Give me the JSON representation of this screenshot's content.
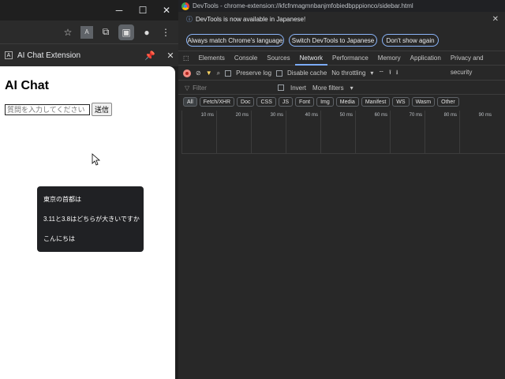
{
  "browser": {
    "side_panel_title": "AI Chat Extension",
    "app": {
      "title": "AI Chat",
      "input_placeholder": "質問を入力してください",
      "send_label": "送信",
      "suggestions": [
        "東京の首都は",
        "3.11と3.8はどちらが大きいですか",
        "こんにちは"
      ]
    }
  },
  "devtools": {
    "window_title": "DevTools - chrome-extension://kfcfnmagmnbanjmfobiedbpppionco/sidebar.html",
    "infobar": {
      "message": "DevTools is now available in Japanese!",
      "buttons": [
        "Always match Chrome's language",
        "Switch DevTools to Japanese",
        "Don't show again"
      ]
    },
    "tabs": [
      "Elements",
      "Console",
      "Sources",
      "Network",
      "Performance",
      "Memory",
      "Application",
      "Privacy and security"
    ],
    "active_tab": "Network",
    "network_toolbar": {
      "preserve_log": "Preserve log",
      "disable_cache": "Disable cache",
      "throttling": "No throttling"
    },
    "filter": {
      "placeholder": "Filter",
      "invert": "Invert",
      "more_filters": "More filters"
    },
    "types": [
      "All",
      "Fetch/XHR",
      "Doc",
      "CSS",
      "JS",
      "Font",
      "Img",
      "Media",
      "Manifest",
      "WS",
      "Wasm",
      "Other"
    ],
    "timeline_ticks": [
      "10 ms",
      "20 ms",
      "30 ms",
      "40 ms",
      "50 ms",
      "60 ms",
      "70 ms",
      "80 ms",
      "90 ms"
    ]
  }
}
